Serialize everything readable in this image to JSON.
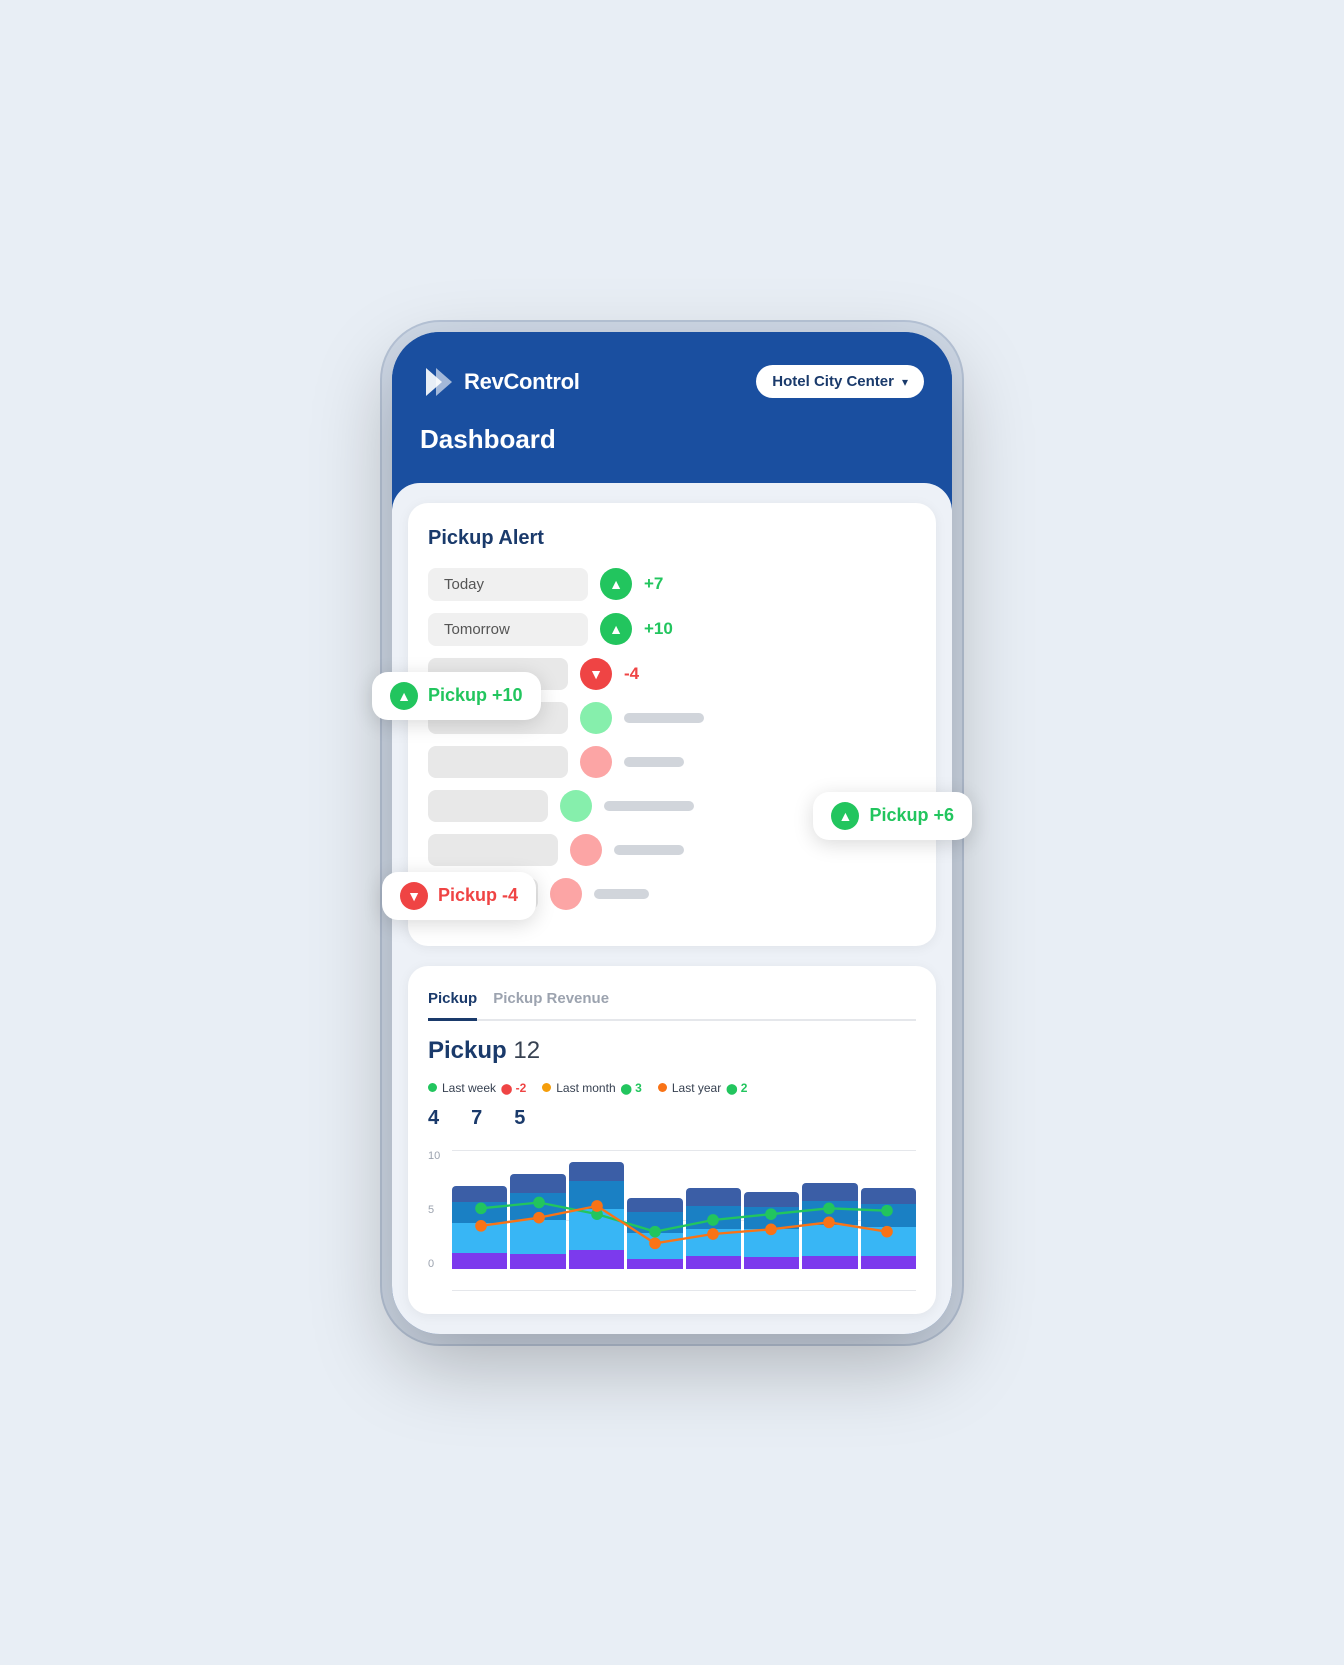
{
  "app": {
    "logo_text": "RevControl",
    "hotel_name": "Hotel City Center",
    "dashboard_title": "Dashboard"
  },
  "tabs": {
    "pickup": "Pickup",
    "pickup_revenue": "Pickup Revenue"
  },
  "pickup_alert": {
    "title": "Pickup Alert",
    "rows": [
      {
        "label": "Today",
        "indicator": "green",
        "value": "+7",
        "value_color": "green"
      },
      {
        "label": "Tomorrow",
        "indicator": "green",
        "value": "+10",
        "value_color": "green"
      },
      {
        "label": "",
        "indicator": "red",
        "value": "-4",
        "value_color": "red"
      },
      {
        "label": "",
        "indicator": "green_soft",
        "value": "",
        "value_color": "green_soft"
      },
      {
        "label": "",
        "indicator": "red_soft",
        "value": "",
        "value_color": "red_soft"
      },
      {
        "label": "",
        "indicator": "green_soft",
        "value": "",
        "value_color": "green_soft"
      },
      {
        "label": "",
        "indicator": "red_soft",
        "value": "",
        "value_color": "red_soft"
      },
      {
        "label": "",
        "indicator": "red_soft",
        "value": "",
        "value_color": "red_soft"
      }
    ]
  },
  "pickup_chart": {
    "title": "Pickup",
    "number": "12",
    "legend": [
      {
        "label": "Last week",
        "color": "#22c55e",
        "change": "-2",
        "change_type": "negative"
      },
      {
        "label": "Last month",
        "color": "#f59e0b",
        "change": "3",
        "change_type": "positive"
      },
      {
        "label": "Last year",
        "color": "#f97316",
        "change": "2",
        "change_type": "positive"
      }
    ],
    "stats": [
      {
        "value": "4"
      },
      {
        "value": "7"
      },
      {
        "value": "5"
      }
    ],
    "y_labels": [
      "10",
      "5",
      "0"
    ],
    "bars": [
      {
        "segments": [
          15,
          20,
          30,
          10
        ],
        "line_val": 70
      },
      {
        "segments": [
          18,
          22,
          28,
          12
        ],
        "line_val": 75
      },
      {
        "segments": [
          20,
          25,
          35,
          15
        ],
        "line_val": 65
      },
      {
        "segments": [
          12,
          18,
          25,
          8
        ],
        "line_val": 55
      },
      {
        "segments": [
          16,
          20,
          30,
          10
        ],
        "line_val": 60
      },
      {
        "segments": [
          14,
          18,
          28,
          8
        ],
        "line_val": 65
      },
      {
        "segments": [
          17,
          22,
          32,
          11
        ],
        "line_val": 70
      },
      {
        "segments": [
          15,
          20,
          28,
          10
        ],
        "line_val": 68
      }
    ]
  },
  "tooltips": [
    {
      "type": "green",
      "text": "Pickup +10",
      "arrow": "up"
    },
    {
      "type": "green",
      "text": "Pickup +6",
      "arrow": "up"
    },
    {
      "type": "red",
      "text": "Pickup -4",
      "arrow": "down"
    }
  ]
}
